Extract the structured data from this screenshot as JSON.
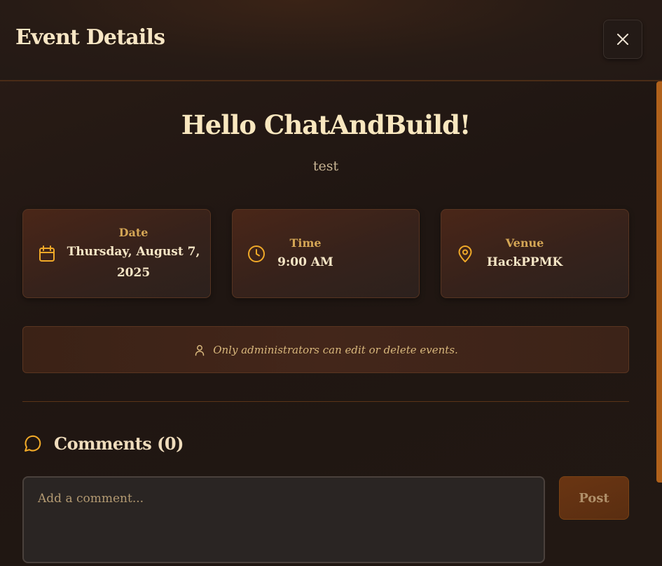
{
  "header": {
    "title": "Event Details",
    "close_icon": "close-icon"
  },
  "event": {
    "title": "Hello ChatAndBuild!",
    "description": "test"
  },
  "details": [
    {
      "icon": "calendar-icon",
      "label": "Date",
      "value_line1": "Thursday, August 7,",
      "value_line2": "2025"
    },
    {
      "icon": "clock-icon",
      "label": "Time",
      "value": "9:00 AM"
    },
    {
      "icon": "map-pin-icon",
      "label": "Venue",
      "value": "HackPPMK"
    }
  ],
  "notice": {
    "icon": "user-icon",
    "text": "Only administrators can edit or delete events."
  },
  "comments": {
    "icon": "message-circle-icon",
    "title": "Comments (0)",
    "input_placeholder": "Add a comment...",
    "input_value": "",
    "post_label": "Post"
  },
  "colors": {
    "accent": "#f0a928",
    "label": "#d4a655",
    "heading": "#f9e7bf",
    "scrollbar": "#b0611b"
  }
}
